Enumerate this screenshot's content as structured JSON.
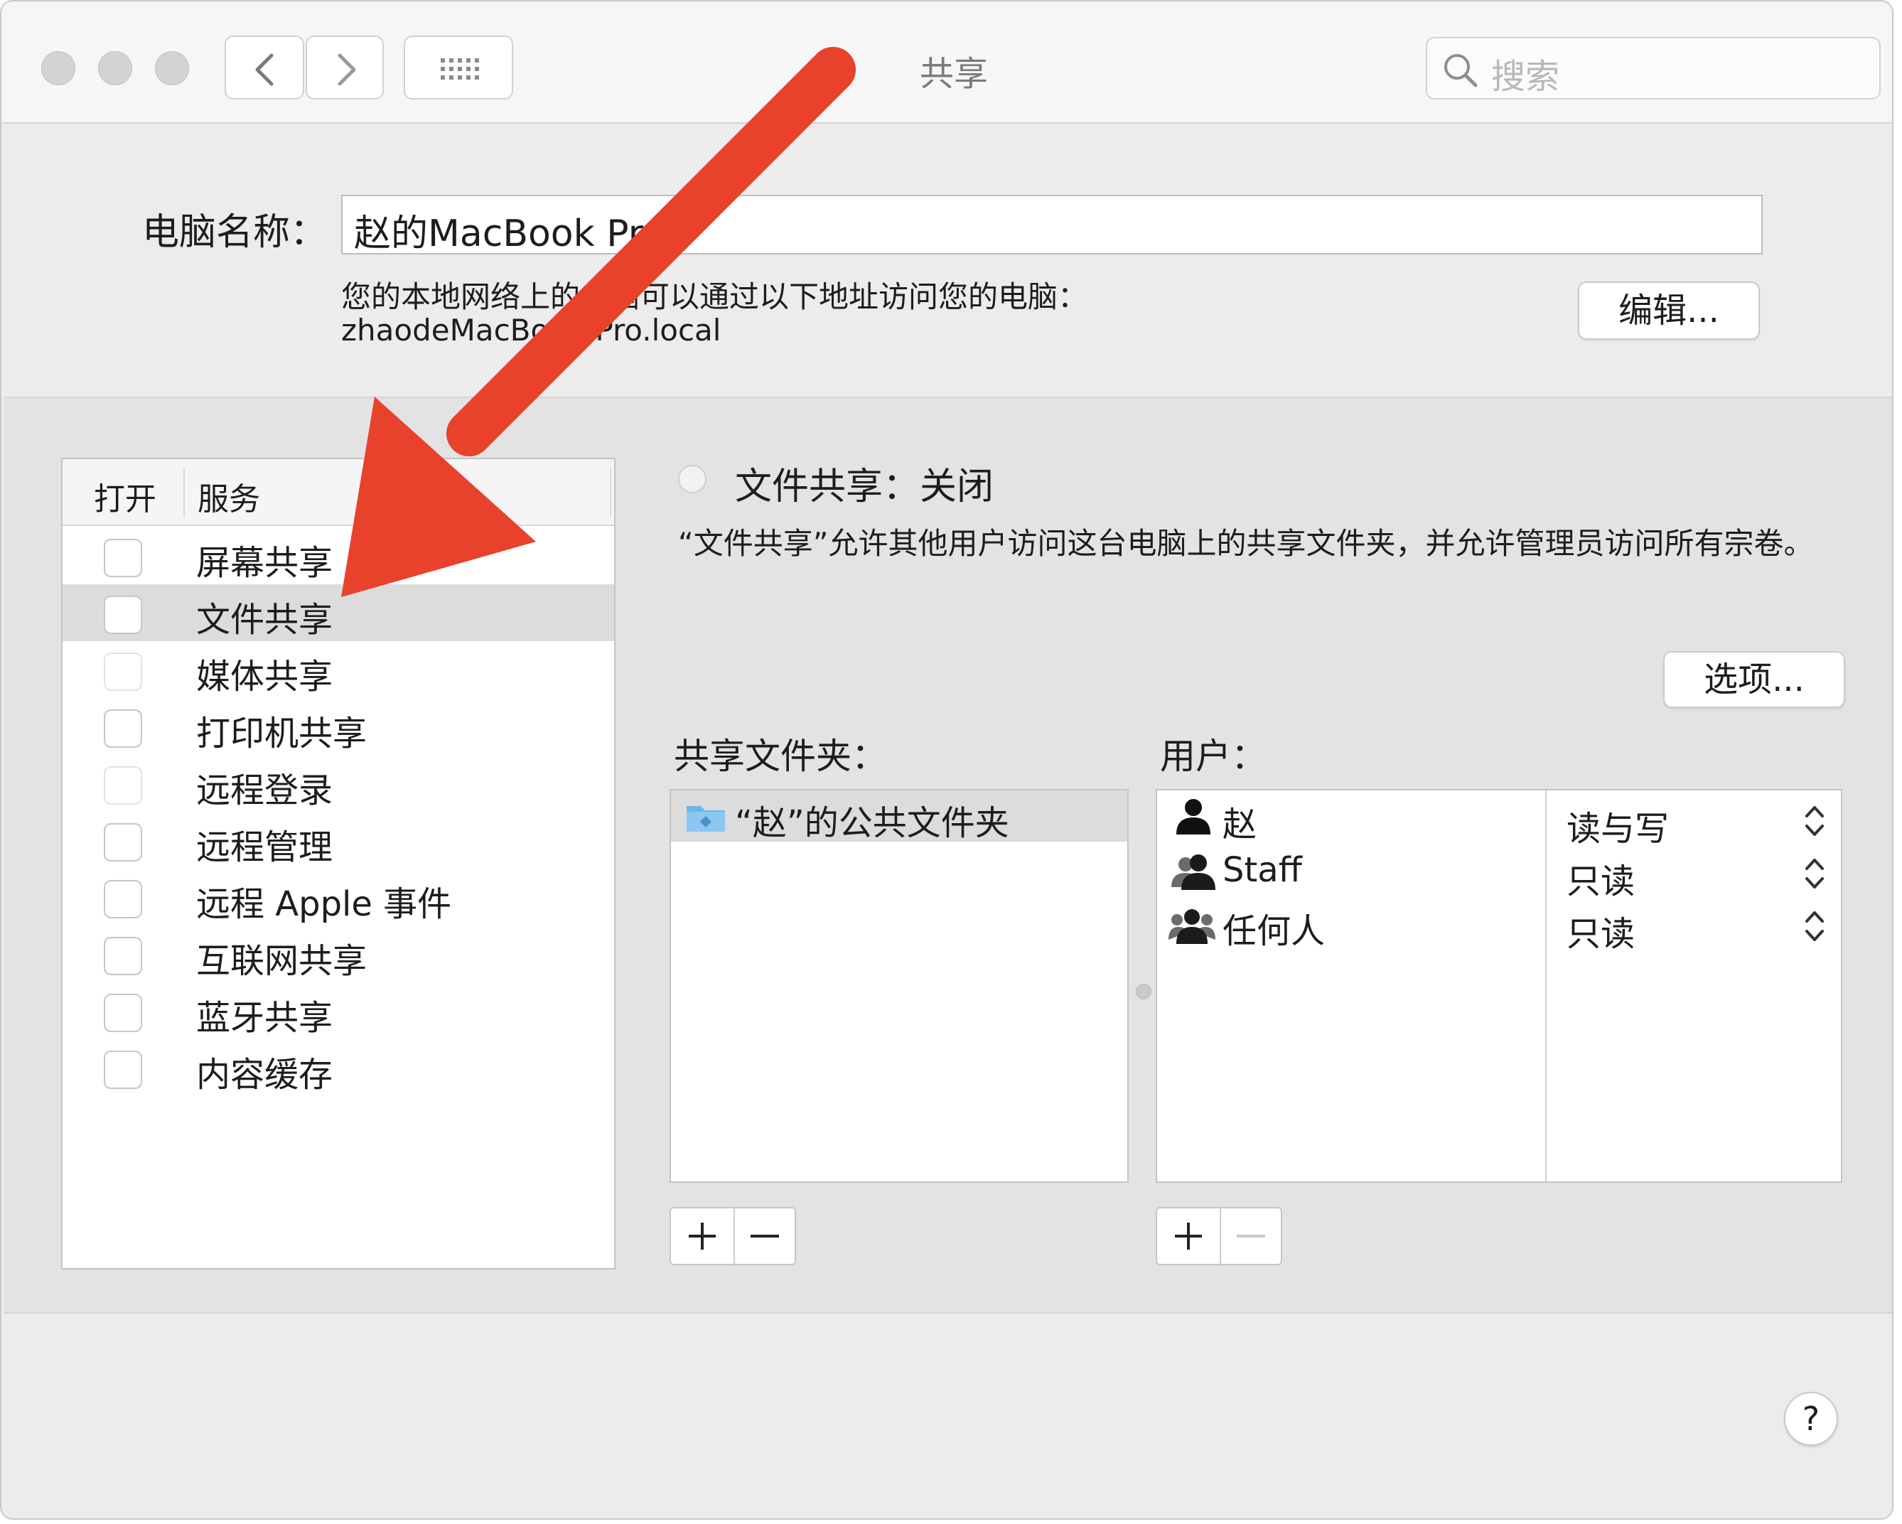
{
  "window": {
    "title": "共享"
  },
  "search": {
    "placeholder": "搜索"
  },
  "computer_name": {
    "label": "电脑名称：",
    "value": "赵的MacBook Pro",
    "address_description": "您的本地网络上的电脑可以通过以下地址访问您的电脑：",
    "address": "zhaodeMacBook-Pro.local",
    "edit_button": "编辑..."
  },
  "service_list": {
    "header_on": "打开",
    "header_service": "服务",
    "items": [
      {
        "label": "屏幕共享",
        "checked": false,
        "selected": false
      },
      {
        "label": "文件共享",
        "checked": false,
        "selected": true
      },
      {
        "label": "媒体共享",
        "checked": false,
        "selected": false
      },
      {
        "label": "打印机共享",
        "checked": false,
        "selected": false
      },
      {
        "label": "远程登录",
        "checked": false,
        "selected": false
      },
      {
        "label": "远程管理",
        "checked": false,
        "selected": false
      },
      {
        "label": "远程 Apple 事件",
        "checked": false,
        "selected": false
      },
      {
        "label": "互联网共享",
        "checked": false,
        "selected": false
      },
      {
        "label": "蓝牙共享",
        "checked": false,
        "selected": false
      },
      {
        "label": "内容缓存",
        "checked": false,
        "selected": false
      }
    ]
  },
  "detail": {
    "status": "文件共享：关闭",
    "description": "“文件共享”允许其他用户访问这台电脑上的共享文件夹，并允许管理员访问所有宗卷。",
    "options_button": "选项...",
    "shared_folders_label": "共享文件夹：",
    "shared_folders": [
      "“赵”的公共文件夹"
    ],
    "users_label": "用户：",
    "users": [
      {
        "name": "赵",
        "icon": "user-icon",
        "permission": "读与写"
      },
      {
        "name": "Staff",
        "icon": "group-icon",
        "permission": "只读"
      },
      {
        "name": "任何人",
        "icon": "everyone-icon",
        "permission": "只读"
      }
    ],
    "add_symbol": "+",
    "remove_symbol": "−"
  },
  "help_button": "?",
  "colors": {
    "annotation_arrow": "#e8412c"
  }
}
